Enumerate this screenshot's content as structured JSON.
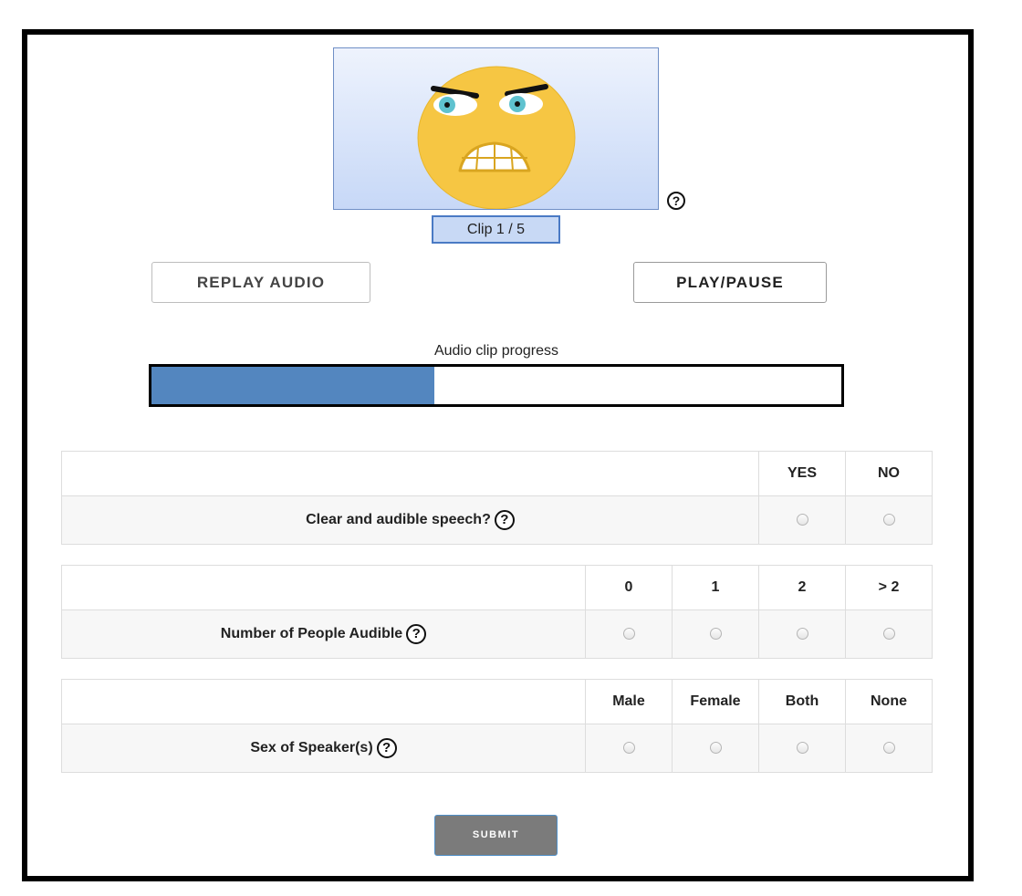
{
  "stimulus": {
    "face_icon": "angry-face-icon",
    "help_icon": "question-circle-icon",
    "help_glyph": "?",
    "clip_label": "Clip 1 / 5"
  },
  "controls": {
    "replay_label": "REPLAY AUDIO",
    "play_pause_label": "PLAY/PAUSE"
  },
  "progress": {
    "label": "Audio clip progress",
    "value": 0.41,
    "fill_color": "#5386bf"
  },
  "questions": [
    {
      "label": "Clear and audible speech?",
      "options": [
        "YES",
        "NO"
      ]
    },
    {
      "label": "Number of People Audible",
      "options": [
        "0",
        "1",
        "2",
        "> 2"
      ]
    },
    {
      "label": "Sex of Speaker(s)",
      "options": [
        "Male",
        "Female",
        "Both",
        "None"
      ]
    }
  ],
  "submit_label": "SUBMIT",
  "colors": {
    "frame_border": "#000000",
    "face": "#f6c643",
    "eye": "#5fc2cf",
    "submit_bg": "#7b7b7b",
    "clip_label_bg": "#c8d9f5"
  }
}
